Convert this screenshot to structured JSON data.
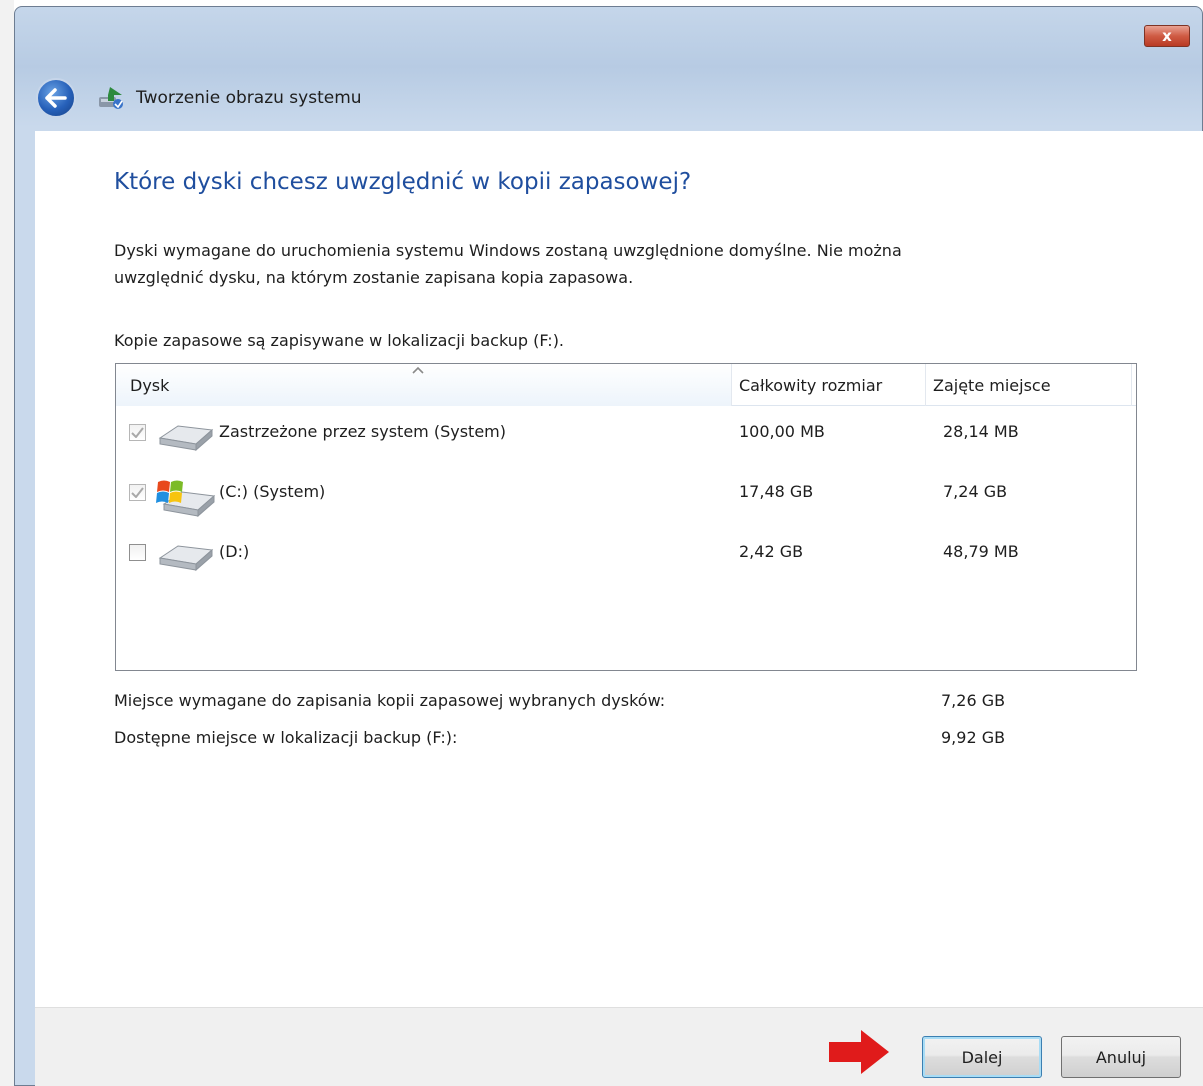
{
  "window": {
    "title": "Tworzenie obrazu systemu",
    "close_label": "x"
  },
  "main": {
    "heading": "Które dyski chcesz uwzględnić w kopii zapasowej?",
    "description_line1": "Dyski wymagane do uruchomienia systemu Windows zostaną uwzględnione domyślne. Nie można",
    "description_line2": "uwzględnić dysku, na którym zostanie zapisana kopia zapasowa.",
    "location_text": "Kopie zapasowe są zapisywane w lokalizacji backup (F:)."
  },
  "disk_list": {
    "columns": {
      "disk": "Dysk",
      "total_size": "Całkowity rozmiar",
      "used_space": "Zajęte miejsce"
    },
    "sort_column": "disk",
    "rows": [
      {
        "checked": true,
        "disabled": true,
        "icon": "hard-drive-icon",
        "name": "Zastrzeżone przez system (System)",
        "total_size": "100,00 MB",
        "used_space": "28,14 MB"
      },
      {
        "checked": true,
        "disabled": true,
        "icon": "windows-drive-icon",
        "name": "(C:) (System)",
        "total_size": "17,48 GB",
        "used_space": "7,24 GB"
      },
      {
        "checked": false,
        "disabled": false,
        "icon": "hard-drive-icon",
        "name": "(D:)",
        "total_size": "2,42 GB",
        "used_space": "48,79 MB"
      }
    ]
  },
  "summary": {
    "required_label": "Miejsce wymagane do zapisania kopii zapasowej wybranych dysków:",
    "required_value": "7,26 GB",
    "available_label": "Dostępne miejsce w lokalizacji backup (F:):",
    "available_value": "9,92 GB"
  },
  "footer": {
    "next_label": "Dalej",
    "cancel_label": "Anuluj"
  },
  "colors": {
    "heading": "#1f4e9e",
    "arrow_annotation": "#e01b1b"
  }
}
